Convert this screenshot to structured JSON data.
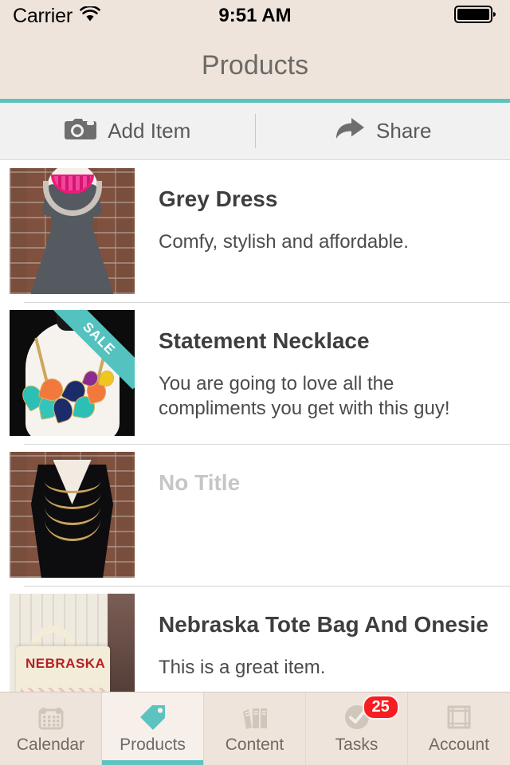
{
  "status_bar": {
    "carrier": "Carrier",
    "time": "9:51 AM",
    "wifi_icon": "wifi-icon",
    "battery_icon": "battery-full-icon"
  },
  "nav": {
    "title": "Products",
    "accent_color": "#5CC3C0",
    "background_color": "#EFE4DC"
  },
  "toolbar": {
    "add_item_label": "Add Item",
    "add_item_icon": "camera-icon",
    "share_label": "Share",
    "share_icon": "share-arrow-icon"
  },
  "products": [
    {
      "title": "Grey Dress",
      "description": "Comfy, stylish and affordable.",
      "thumbnail": "grey-dress-photo",
      "badge": null,
      "title_is_placeholder": false
    },
    {
      "title": "Statement Necklace",
      "description": "You are going to love all the compliments you get with this guy!",
      "thumbnail": "statement-necklace-photo",
      "badge": "SALE",
      "title_is_placeholder": false
    },
    {
      "title": "No Title",
      "description": "",
      "thumbnail": "black-dress-photo",
      "badge": null,
      "title_is_placeholder": true
    },
    {
      "title": "Nebraska Tote Bag And Onesie",
      "description": "This is a great item.",
      "thumbnail": "nebraska-tote-photo",
      "badge": null,
      "title_is_placeholder": false
    }
  ],
  "tabs": [
    {
      "label": "Calendar",
      "icon": "calendar-icon",
      "active": false,
      "badge": null
    },
    {
      "label": "Products",
      "icon": "tag-icon",
      "active": true,
      "badge": null
    },
    {
      "label": "Content",
      "icon": "books-icon",
      "active": false,
      "badge": null
    },
    {
      "label": "Tasks",
      "icon": "check-circle-icon",
      "active": false,
      "badge": "25"
    },
    {
      "label": "Account",
      "icon": "frame-icon",
      "active": false,
      "badge": null
    }
  ],
  "colors": {
    "accent_teal": "#5CC3C0",
    "cream": "#EFE4DC",
    "badge_red": "#F51E20",
    "title_grey": "#3E3E3E",
    "placeholder_grey": "#C6C6C6"
  }
}
